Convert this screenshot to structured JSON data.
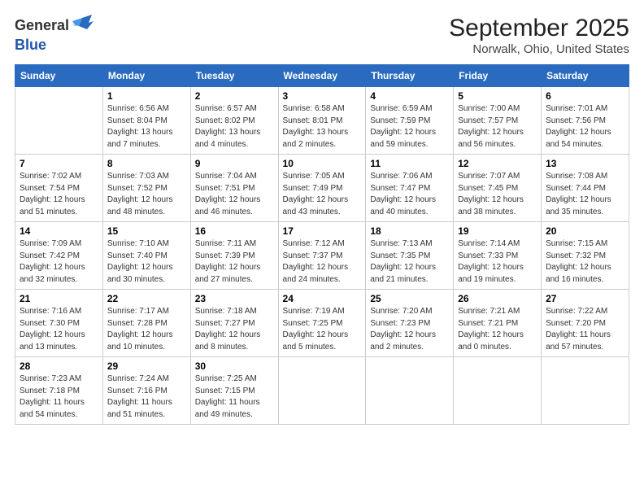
{
  "header": {
    "logo_general": "General",
    "logo_blue": "Blue",
    "month": "September 2025",
    "location": "Norwalk, Ohio, United States"
  },
  "days_of_week": [
    "Sunday",
    "Monday",
    "Tuesday",
    "Wednesday",
    "Thursday",
    "Friday",
    "Saturday"
  ],
  "weeks": [
    [
      {
        "day": "",
        "sunrise": "",
        "sunset": "",
        "daylight": ""
      },
      {
        "day": "1",
        "sunrise": "Sunrise: 6:56 AM",
        "sunset": "Sunset: 8:04 PM",
        "daylight": "Daylight: 13 hours and 7 minutes."
      },
      {
        "day": "2",
        "sunrise": "Sunrise: 6:57 AM",
        "sunset": "Sunset: 8:02 PM",
        "daylight": "Daylight: 13 hours and 4 minutes."
      },
      {
        "day": "3",
        "sunrise": "Sunrise: 6:58 AM",
        "sunset": "Sunset: 8:01 PM",
        "daylight": "Daylight: 13 hours and 2 minutes."
      },
      {
        "day": "4",
        "sunrise": "Sunrise: 6:59 AM",
        "sunset": "Sunset: 7:59 PM",
        "daylight": "Daylight: 12 hours and 59 minutes."
      },
      {
        "day": "5",
        "sunrise": "Sunrise: 7:00 AM",
        "sunset": "Sunset: 7:57 PM",
        "daylight": "Daylight: 12 hours and 56 minutes."
      },
      {
        "day": "6",
        "sunrise": "Sunrise: 7:01 AM",
        "sunset": "Sunset: 7:56 PM",
        "daylight": "Daylight: 12 hours and 54 minutes."
      }
    ],
    [
      {
        "day": "7",
        "sunrise": "Sunrise: 7:02 AM",
        "sunset": "Sunset: 7:54 PM",
        "daylight": "Daylight: 12 hours and 51 minutes."
      },
      {
        "day": "8",
        "sunrise": "Sunrise: 7:03 AM",
        "sunset": "Sunset: 7:52 PM",
        "daylight": "Daylight: 12 hours and 48 minutes."
      },
      {
        "day": "9",
        "sunrise": "Sunrise: 7:04 AM",
        "sunset": "Sunset: 7:51 PM",
        "daylight": "Daylight: 12 hours and 46 minutes."
      },
      {
        "day": "10",
        "sunrise": "Sunrise: 7:05 AM",
        "sunset": "Sunset: 7:49 PM",
        "daylight": "Daylight: 12 hours and 43 minutes."
      },
      {
        "day": "11",
        "sunrise": "Sunrise: 7:06 AM",
        "sunset": "Sunset: 7:47 PM",
        "daylight": "Daylight: 12 hours and 40 minutes."
      },
      {
        "day": "12",
        "sunrise": "Sunrise: 7:07 AM",
        "sunset": "Sunset: 7:45 PM",
        "daylight": "Daylight: 12 hours and 38 minutes."
      },
      {
        "day": "13",
        "sunrise": "Sunrise: 7:08 AM",
        "sunset": "Sunset: 7:44 PM",
        "daylight": "Daylight: 12 hours and 35 minutes."
      }
    ],
    [
      {
        "day": "14",
        "sunrise": "Sunrise: 7:09 AM",
        "sunset": "Sunset: 7:42 PM",
        "daylight": "Daylight: 12 hours and 32 minutes."
      },
      {
        "day": "15",
        "sunrise": "Sunrise: 7:10 AM",
        "sunset": "Sunset: 7:40 PM",
        "daylight": "Daylight: 12 hours and 30 minutes."
      },
      {
        "day": "16",
        "sunrise": "Sunrise: 7:11 AM",
        "sunset": "Sunset: 7:39 PM",
        "daylight": "Daylight: 12 hours and 27 minutes."
      },
      {
        "day": "17",
        "sunrise": "Sunrise: 7:12 AM",
        "sunset": "Sunset: 7:37 PM",
        "daylight": "Daylight: 12 hours and 24 minutes."
      },
      {
        "day": "18",
        "sunrise": "Sunrise: 7:13 AM",
        "sunset": "Sunset: 7:35 PM",
        "daylight": "Daylight: 12 hours and 21 minutes."
      },
      {
        "day": "19",
        "sunrise": "Sunrise: 7:14 AM",
        "sunset": "Sunset: 7:33 PM",
        "daylight": "Daylight: 12 hours and 19 minutes."
      },
      {
        "day": "20",
        "sunrise": "Sunrise: 7:15 AM",
        "sunset": "Sunset: 7:32 PM",
        "daylight": "Daylight: 12 hours and 16 minutes."
      }
    ],
    [
      {
        "day": "21",
        "sunrise": "Sunrise: 7:16 AM",
        "sunset": "Sunset: 7:30 PM",
        "daylight": "Daylight: 12 hours and 13 minutes."
      },
      {
        "day": "22",
        "sunrise": "Sunrise: 7:17 AM",
        "sunset": "Sunset: 7:28 PM",
        "daylight": "Daylight: 12 hours and 10 minutes."
      },
      {
        "day": "23",
        "sunrise": "Sunrise: 7:18 AM",
        "sunset": "Sunset: 7:27 PM",
        "daylight": "Daylight: 12 hours and 8 minutes."
      },
      {
        "day": "24",
        "sunrise": "Sunrise: 7:19 AM",
        "sunset": "Sunset: 7:25 PM",
        "daylight": "Daylight: 12 hours and 5 minutes."
      },
      {
        "day": "25",
        "sunrise": "Sunrise: 7:20 AM",
        "sunset": "Sunset: 7:23 PM",
        "daylight": "Daylight: 12 hours and 2 minutes."
      },
      {
        "day": "26",
        "sunrise": "Sunrise: 7:21 AM",
        "sunset": "Sunset: 7:21 PM",
        "daylight": "Daylight: 12 hours and 0 minutes."
      },
      {
        "day": "27",
        "sunrise": "Sunrise: 7:22 AM",
        "sunset": "Sunset: 7:20 PM",
        "daylight": "Daylight: 11 hours and 57 minutes."
      }
    ],
    [
      {
        "day": "28",
        "sunrise": "Sunrise: 7:23 AM",
        "sunset": "Sunset: 7:18 PM",
        "daylight": "Daylight: 11 hours and 54 minutes."
      },
      {
        "day": "29",
        "sunrise": "Sunrise: 7:24 AM",
        "sunset": "Sunset: 7:16 PM",
        "daylight": "Daylight: 11 hours and 51 minutes."
      },
      {
        "day": "30",
        "sunrise": "Sunrise: 7:25 AM",
        "sunset": "Sunset: 7:15 PM",
        "daylight": "Daylight: 11 hours and 49 minutes."
      },
      {
        "day": "",
        "sunrise": "",
        "sunset": "",
        "daylight": ""
      },
      {
        "day": "",
        "sunrise": "",
        "sunset": "",
        "daylight": ""
      },
      {
        "day": "",
        "sunrise": "",
        "sunset": "",
        "daylight": ""
      },
      {
        "day": "",
        "sunrise": "",
        "sunset": "",
        "daylight": ""
      }
    ]
  ]
}
